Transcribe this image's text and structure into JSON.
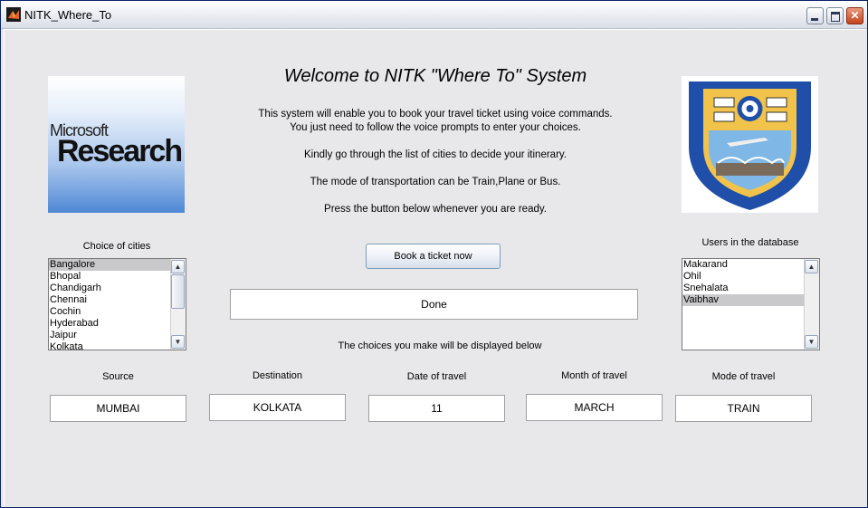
{
  "window": {
    "title": "NITK_Where_To"
  },
  "heading": "Welcome to NITK \"Where To\" System",
  "description": [
    "This system will enable you to book your travel ticket using voice commands.",
    "You just need to follow the voice prompts to enter your choices.",
    "Kindly go through the list of cities to decide your itinerary.",
    "The mode of transportation can be Train,Plane or Bus.",
    "Press the button below whenever you are ready."
  ],
  "logos": {
    "microsoft_line1": "Microsoft",
    "microsoft_line2": "Research"
  },
  "cities": {
    "label": "Choice of cities",
    "items": [
      "Bangalore",
      "Bhopal",
      "Chandigarh",
      "Chennai",
      "Cochin",
      "Hyderabad",
      "Jaipur",
      "Kolkata"
    ],
    "selected": "Bangalore"
  },
  "users": {
    "label": "Users in the database",
    "items": [
      "Makarand",
      "Ohil",
      "Snehalata",
      "Vaibhav"
    ],
    "selected": "Vaibhav"
  },
  "book_button": "Book a ticket now",
  "status": "Done",
  "choices_note": "The choices you make will be displayed below",
  "fields": {
    "source": {
      "label": "Source",
      "value": "MUMBAI"
    },
    "destination": {
      "label": "Destination",
      "value": "KOLKATA"
    },
    "date": {
      "label": "Date of travel",
      "value": "11"
    },
    "month": {
      "label": "Month of travel",
      "value": "MARCH"
    },
    "mode": {
      "label": "Mode of travel",
      "value": "TRAIN"
    }
  }
}
